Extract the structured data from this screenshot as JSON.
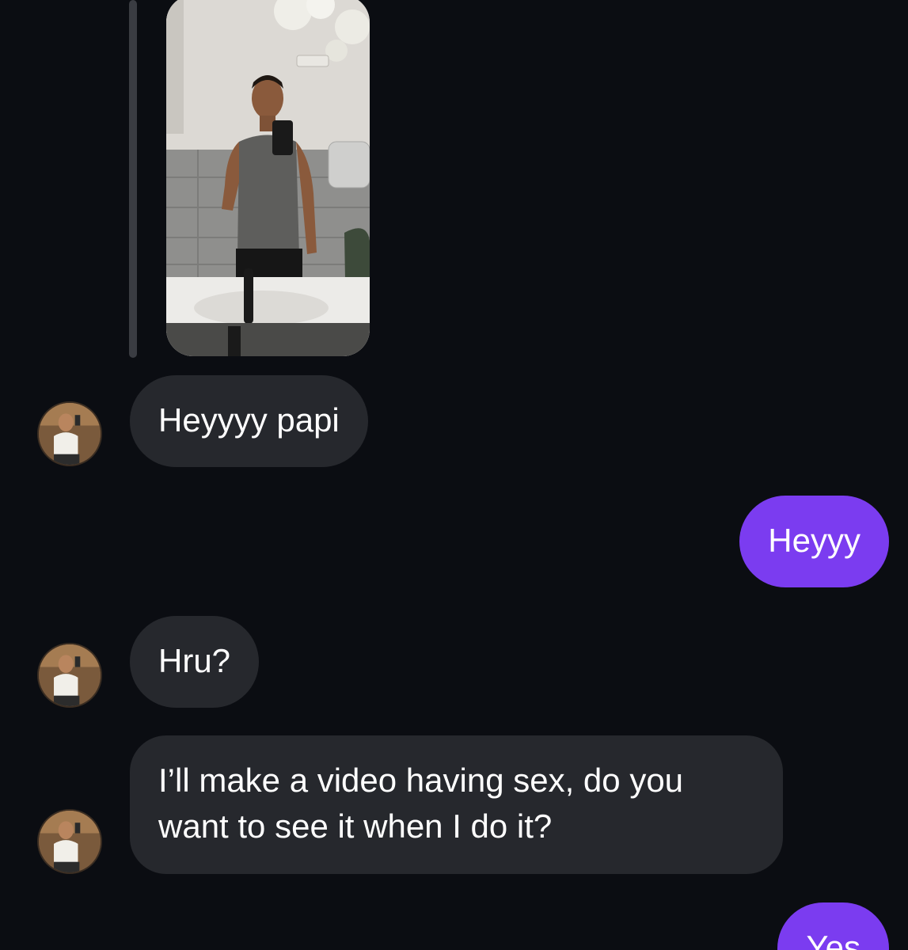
{
  "conversation": {
    "shared_photo": {
      "icon": "mirror-selfie-photo"
    },
    "messages": [
      {
        "direction": "incoming",
        "text": "Heyyyy papi",
        "avatar_icon": "contact-avatar"
      },
      {
        "direction": "outgoing",
        "text": "Heyyy"
      },
      {
        "direction": "incoming",
        "text": "Hru?",
        "avatar_icon": "contact-avatar"
      },
      {
        "direction": "incoming",
        "text": "I’ll make a video having sex, do you want to see it when I do it?",
        "avatar_icon": "contact-avatar"
      },
      {
        "direction": "outgoing",
        "text": "Yes"
      }
    ]
  },
  "colors": {
    "background": "#0b0d12",
    "incoming_bubble": "#26282d",
    "outgoing_bubble": "#7b3cf0",
    "text": "#ffffff"
  }
}
